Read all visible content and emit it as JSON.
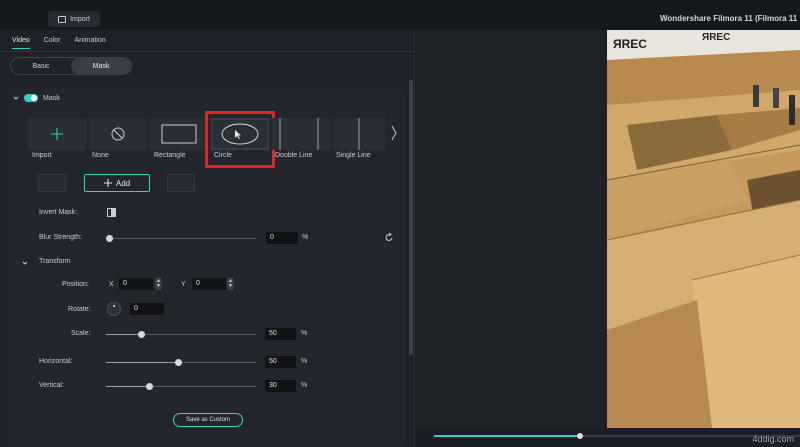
{
  "toolbar": {
    "import_label": "Import"
  },
  "app": {
    "title": "Wondershare Filmora 11 (Filmora 11"
  },
  "tabs": [
    {
      "label": "Video",
      "active": true
    },
    {
      "label": "Color",
      "active": false
    },
    {
      "label": "Animation",
      "active": false
    }
  ],
  "segment": {
    "basic": "Basic",
    "mask": "Mask",
    "selected": "Mask"
  },
  "mask": {
    "title": "Mask",
    "enabled": true,
    "shapes": [
      "Import",
      "None",
      "Rectangle",
      "Circle",
      "Double Line",
      "Single Line"
    ],
    "selected_shape": "Circle",
    "add_label": "Add"
  },
  "invert": {
    "label": "Invert Mask:"
  },
  "blur": {
    "label": "Blur Strength:",
    "value": "0",
    "unit": "%"
  },
  "transform": {
    "title": "Transform",
    "position_label": "Position:",
    "x_label": "X",
    "x_value": "0",
    "y_label": "Y",
    "y_value": "0",
    "rotate_label": "Rotate:",
    "rotate_value": "0",
    "scale_label": "Scale:",
    "scale_value": "50",
    "scale_unit": "%"
  },
  "horizontal": {
    "label": "Horizontal:",
    "value": "50",
    "unit": "%"
  },
  "vertical": {
    "label": "Vertical:",
    "value": "30",
    "unit": "%"
  },
  "save_custom_label": "Save as Custom",
  "preview": {
    "sign_text": "ЯREC",
    "progress": 0.4
  },
  "watermark": "4ddig.com",
  "colors": {
    "accent": "#2fd1c5",
    "highlight": "#e0262a",
    "panel": "#1f2228"
  },
  "icons": [
    "import-icon",
    "plus-icon",
    "none-icon",
    "rectangle-icon",
    "ellipse-icon",
    "chevron-right-icon",
    "invert-icon",
    "reset-icon",
    "chevron-down-icon"
  ]
}
